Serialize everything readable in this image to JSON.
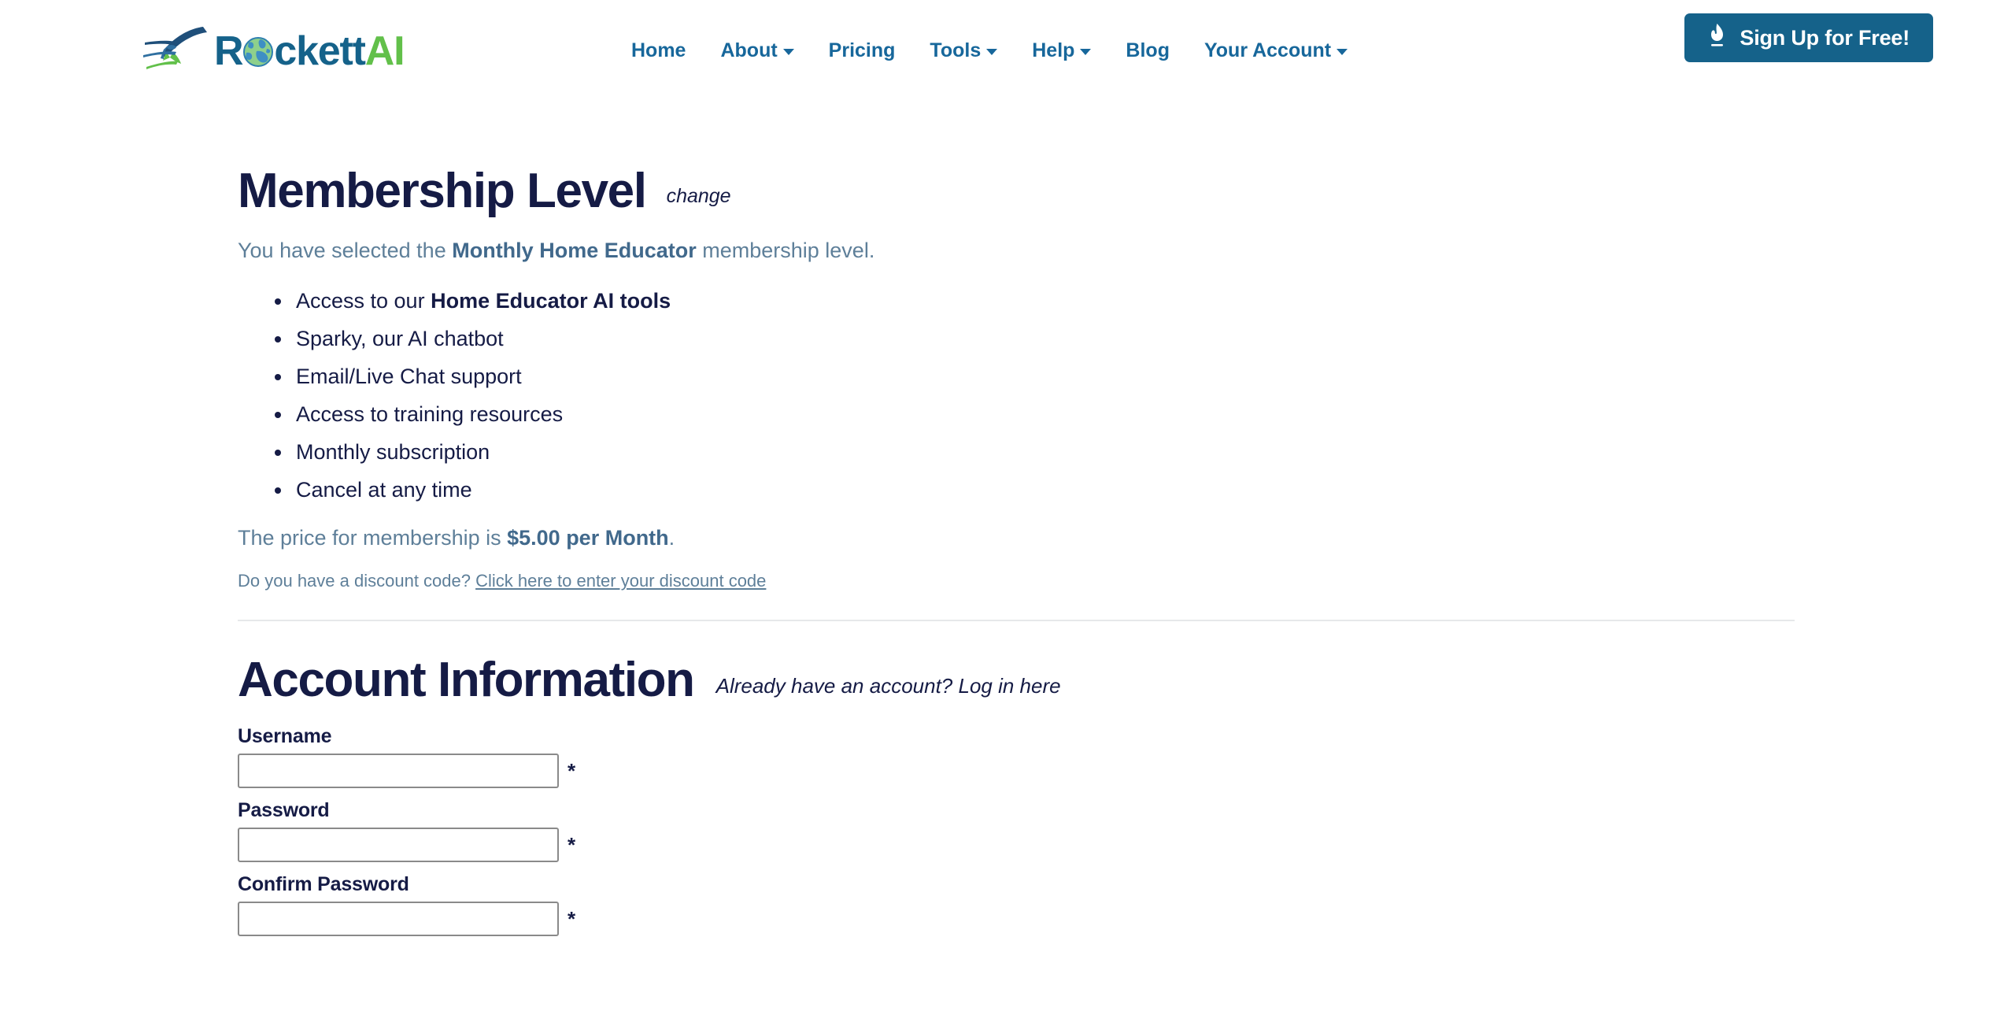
{
  "brand": {
    "icon": "rocket-icon",
    "name_part1": "R",
    "name_globe": "o",
    "name_part2": "ckett",
    "name_suffix": "AI",
    "color_blue": "#15628a",
    "color_green": "#62c04a"
  },
  "nav": {
    "items": [
      {
        "label": "Home",
        "has_dropdown": false
      },
      {
        "label": "About",
        "has_dropdown": true
      },
      {
        "label": "Pricing",
        "has_dropdown": false
      },
      {
        "label": "Tools",
        "has_dropdown": true
      },
      {
        "label": "Help",
        "has_dropdown": true
      },
      {
        "label": "Blog",
        "has_dropdown": false
      },
      {
        "label": "Your Account",
        "has_dropdown": true
      }
    ],
    "color": "#17679b"
  },
  "signup": {
    "label": "Sign Up for Free!",
    "icon": "rocket-flame-icon",
    "bg_color": "#15628a",
    "text_color": "#ffffff"
  },
  "membership": {
    "title": "Membership Level",
    "change_label": "change",
    "selected_prefix": "You have selected the ",
    "selected_level": "Monthly Home Educator",
    "selected_suffix": " membership level.",
    "benefits": [
      {
        "text": "Access to our ",
        "bold": "Home Educator AI tools",
        "after": ""
      },
      {
        "text": "Sparky, our AI chatbot",
        "bold": "",
        "after": ""
      },
      {
        "text": "Email/Live Chat support",
        "bold": "",
        "after": ""
      },
      {
        "text": "Access to training resources",
        "bold": "",
        "after": ""
      },
      {
        "text": "Monthly subscription",
        "bold": "",
        "after": ""
      },
      {
        "text": "Cancel at any time",
        "bold": "",
        "after": ""
      }
    ],
    "price_prefix": "The price for membership is ",
    "price_value": "$5.00 per Month",
    "price_suffix": ".",
    "discount_prompt": "Do you have a discount code? ",
    "discount_link": "Click here to enter your discount code"
  },
  "account": {
    "title": "Account Information",
    "login_link": "Already have an account? Log in here",
    "required_mark": "*",
    "fields": [
      {
        "label": "Username",
        "value": "",
        "placeholder": "",
        "type": "text",
        "required": true
      },
      {
        "label": "Password",
        "value": "",
        "placeholder": "",
        "type": "password",
        "required": true
      },
      {
        "label": "Confirm Password",
        "value": "",
        "placeholder": "",
        "type": "password",
        "required": true
      }
    ]
  }
}
